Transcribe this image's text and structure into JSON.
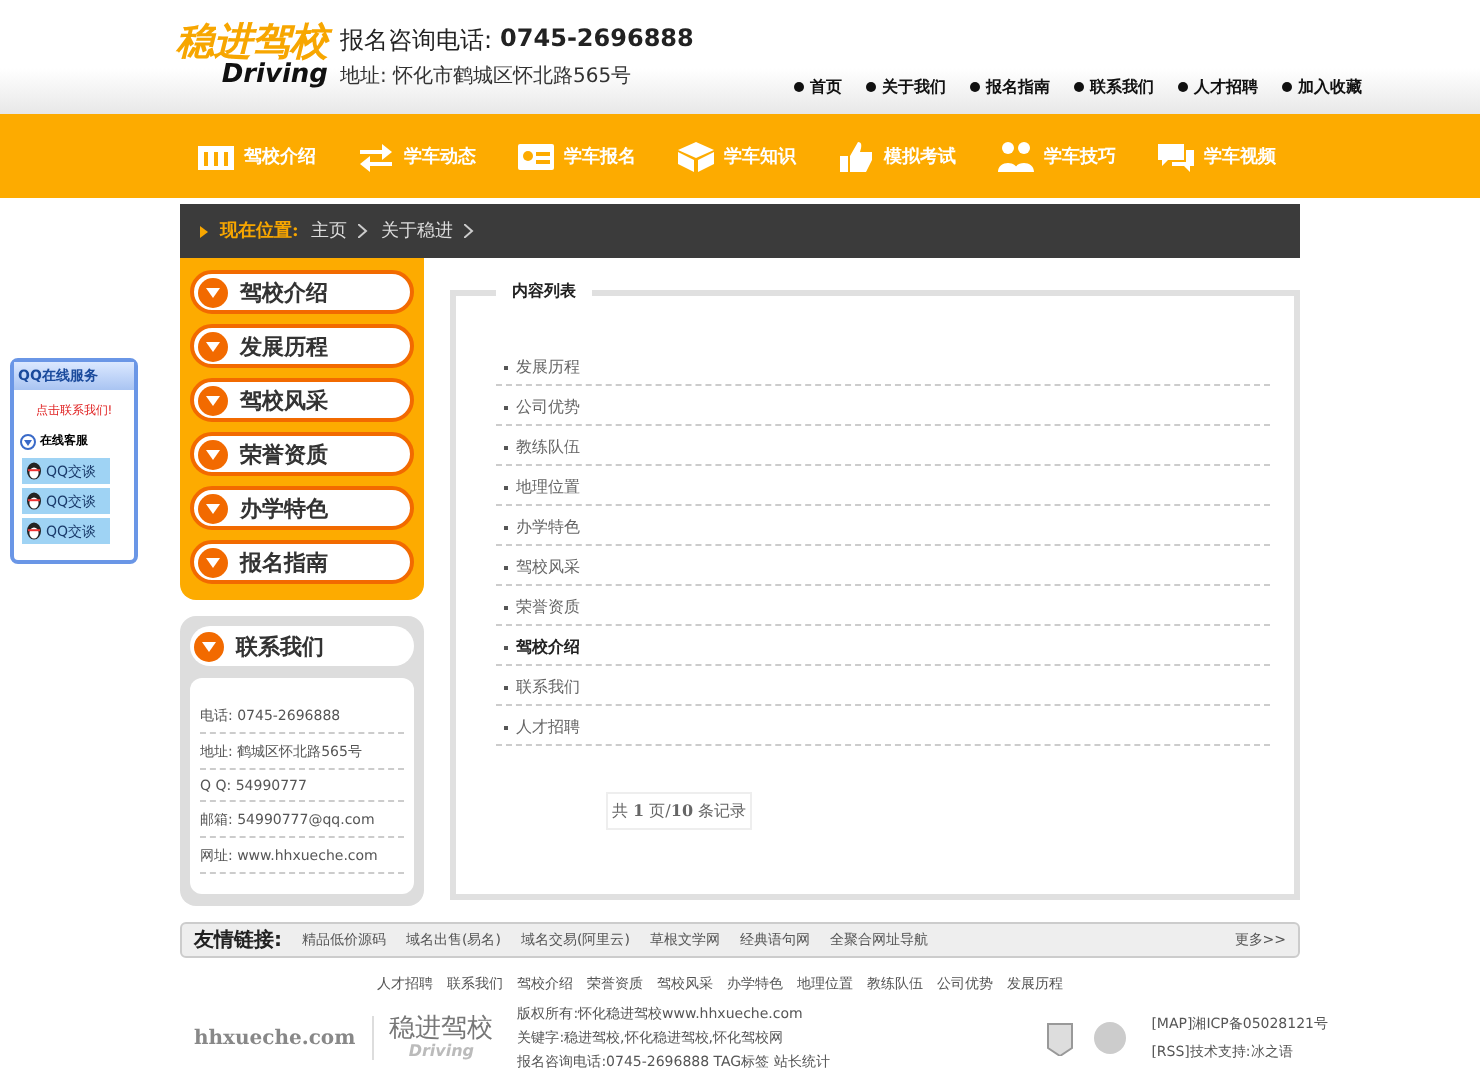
{
  "header": {
    "logo_cn": "稳进驾校",
    "logo_en": "Driving",
    "phone_label": "报名咨询电话:",
    "phone": "0745-2696888",
    "address": "地址:  怀化市鹤城区怀北路565号",
    "top_links": [
      "首页",
      "关于我们",
      "报名指南",
      "联系我们",
      "人才招聘",
      "加入收藏"
    ]
  },
  "nav": [
    {
      "label": "驾校介绍",
      "kind": "building"
    },
    {
      "label": "学车动态",
      "kind": "arrows"
    },
    {
      "label": "学车报名",
      "kind": "card"
    },
    {
      "label": "学车知识",
      "kind": "box"
    },
    {
      "label": "模拟考试",
      "kind": "thumb"
    },
    {
      "label": "学车技巧",
      "kind": "people"
    },
    {
      "label": "学车视频",
      "kind": "chat"
    }
  ],
  "breadcrumb": {
    "label": "现在位置:",
    "items": [
      "主页",
      "关于稳进"
    ]
  },
  "sidebar": {
    "items": [
      "驾校介绍",
      "发展历程",
      "驾校风采",
      "荣誉资质",
      "办学特色",
      "报名指南"
    ]
  },
  "contact": {
    "title": "联系我们",
    "lines": [
      "电话:  0745-2696888",
      "地址:  鹤城区怀北路565号",
      "Q Q:  54990777",
      "邮箱:  54990777@qq.com",
      "网址:  www.hhxueche.com"
    ]
  },
  "qq_widget": {
    "title": "QQ在线服务",
    "hint": "点击联系我们!",
    "group": "在线客服",
    "buttons": [
      "QQ交谈",
      "QQ交谈",
      "QQ交谈"
    ]
  },
  "content": {
    "title": "内容列表",
    "items": [
      {
        "label": "发展历程",
        "selected": false
      },
      {
        "label": "公司优势",
        "selected": false
      },
      {
        "label": "教练队伍",
        "selected": false
      },
      {
        "label": "地理位置",
        "selected": false
      },
      {
        "label": "办学特色",
        "selected": false
      },
      {
        "label": "驾校风采",
        "selected": false
      },
      {
        "label": "荣誉资质",
        "selected": false
      },
      {
        "label": "驾校介绍",
        "selected": true
      },
      {
        "label": "联系我们",
        "selected": false
      },
      {
        "label": "人才招聘",
        "selected": false
      }
    ],
    "pager": "共 **1** 页/**10** 条记录"
  },
  "friend_links": {
    "label": "友情链接:",
    "links": [
      "精品低价源码",
      "域名出售(易名)",
      "域名交易(阿里云)",
      "草根文学网",
      "经典语句网",
      "全聚合网址导航"
    ],
    "more": "更多>>"
  },
  "footer": {
    "links": [
      "人才招聘",
      "联系我们",
      "驾校介绍",
      "荣誉资质",
      "驾校风采",
      "办学特色",
      "地理位置",
      "教练队伍",
      "公司优势",
      "发展历程"
    ],
    "domain": "hhxueche.com",
    "logo_cn": "稳进驾校",
    "logo_en": "Driving",
    "info": [
      "版权所有:怀化稳进驾校www.hhxueche.com",
      "关键字:稳进驾校,怀化稳进驾校,怀化驾校网",
      "报名咨询电话:0745-2696888 TAG标签 站长统计"
    ],
    "right": [
      "[MAP]湘ICP备05028121号",
      "[RSS]技术支持:冰之语"
    ]
  }
}
